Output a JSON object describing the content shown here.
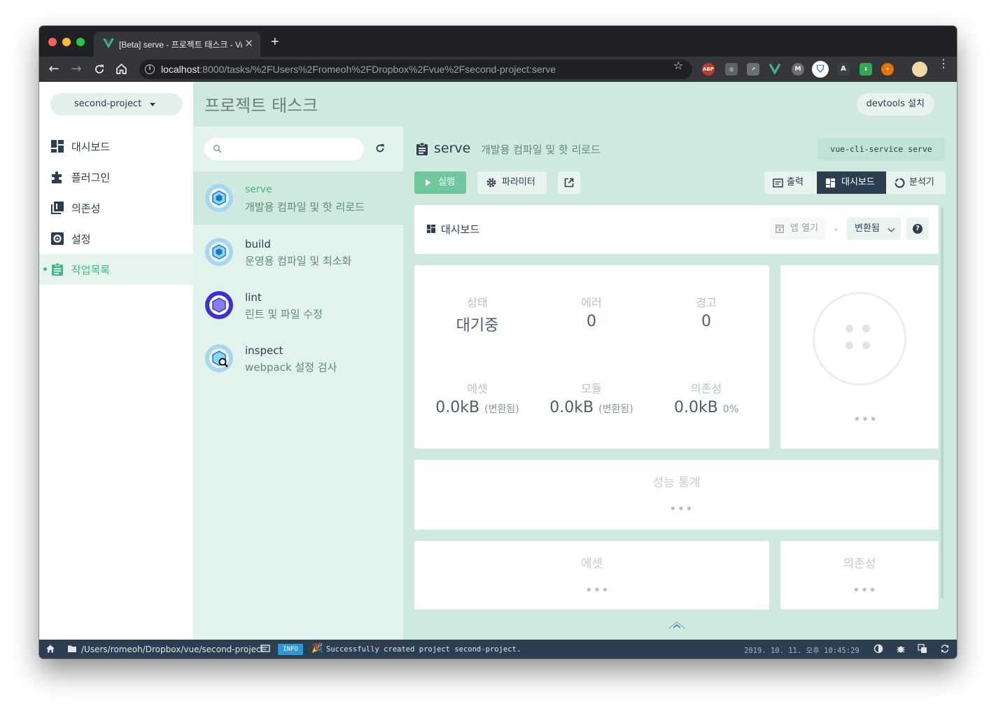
{
  "browser": {
    "tab_title": "[Beta] serve - 프로젝트 태스크 - Vue CLI",
    "url_host": "localhost",
    "url_rest": ":8000/tasks/%2FUsers%2Fromeoh%2FDropbox%2Fvue%2Fsecond-project:serve",
    "extensions": [
      "abp-icon",
      "vpn-icon",
      "chart-icon",
      "vue-devtools-icon",
      "m-icon",
      "shield-icon",
      "text-icon",
      "download-icon",
      "fox-icon",
      "profile-avatar"
    ]
  },
  "sidebar": {
    "project": "second-project",
    "items": [
      {
        "label": "대시보드",
        "icon": "dashboard-icon"
      },
      {
        "label": "플러그인",
        "icon": "puzzle-icon"
      },
      {
        "label": "의존성",
        "icon": "library-icon"
      },
      {
        "label": "설정",
        "icon": "settings-icon"
      },
      {
        "label": "작업목록",
        "icon": "assignment-icon",
        "active": true
      }
    ]
  },
  "header": {
    "title": "프로젝트 태스크",
    "devtools": "devtools 설치"
  },
  "tasklist": {
    "search_placeholder": "",
    "tasks": [
      {
        "name": "serve",
        "desc": "개발용 컴파일 및 핫 리로드",
        "active": true
      },
      {
        "name": "build",
        "desc": "운영용 컴파일 및 최소화"
      },
      {
        "name": "lint",
        "desc": "린트 및 파일 수정"
      },
      {
        "name": "inspect",
        "desc": "webpack 설정 검사"
      }
    ]
  },
  "task_detail": {
    "name": "serve",
    "desc": "개발용 컴파일 및 핫 리로드",
    "command": "vue-cli-service serve",
    "run_label": "실행",
    "params_label": "파라미터",
    "views": {
      "output": "출력",
      "dashboard": "대시보드",
      "analyzer": "분석기"
    }
  },
  "dashboard": {
    "title": "대시보드",
    "open_app": "앱 열기",
    "mode": "변환됨",
    "stats": {
      "status": {
        "label": "상태",
        "value": "대기중"
      },
      "errors": {
        "label": "에러",
        "value": "0"
      },
      "warnings": {
        "label": "경고",
        "value": "0"
      },
      "assets": {
        "label": "에셋",
        "value": "0.0kB",
        "note": "(변환됨)"
      },
      "modules": {
        "label": "모듈",
        "value": "0.0kB",
        "note": "(변환됨)"
      },
      "deps": {
        "label": "의존성",
        "value": "0.0kB",
        "note": "0%"
      }
    },
    "graph_placeholder": "•••",
    "perf_title": "성능 통계",
    "perf_placeholder": "•••",
    "assets_title": "에셋",
    "assets_placeholder": "•••",
    "deps_title": "의존성",
    "deps_placeholder": "•••"
  },
  "statusbar": {
    "path": "/Users/romeoh/Dropbox/vue/second-project",
    "badge": "INFO",
    "message": "Successfully created project second-project.",
    "time": "2019. 10. 11. 오후 10:45:29"
  },
  "colors": {
    "accent": "#42b983",
    "dark": "#2c3e50",
    "header_bg": "#cfe9df",
    "tasklist_bg": "#e2f3ec"
  }
}
